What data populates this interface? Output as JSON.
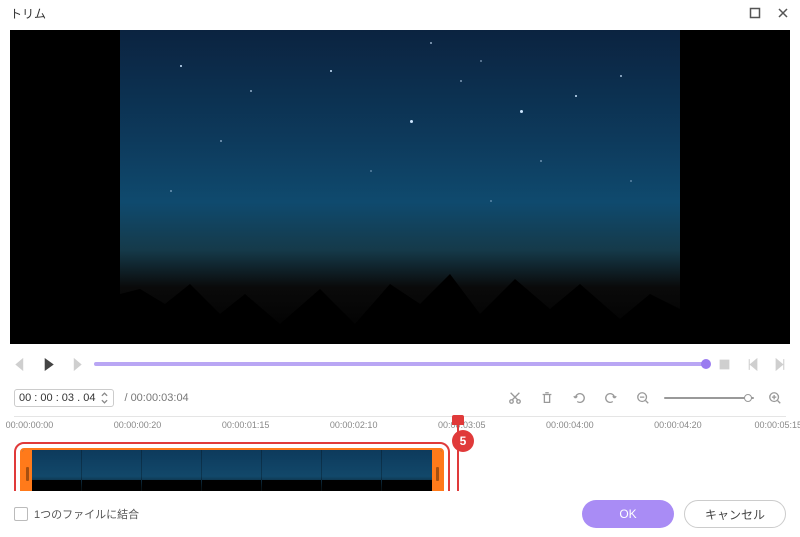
{
  "window": {
    "title": "トリム"
  },
  "playback": {
    "current_time": "00 : 00 : 03 . 04",
    "duration_text": "/ 00:00:03:04"
  },
  "timeline": {
    "ticks": [
      "00:00:00:00",
      "00:00:00:20",
      "00:00:01:15",
      "00:00:02:10",
      "00:00:03:05",
      "00:00:04:00",
      "00:00:04:20",
      "00:00:05:15"
    ]
  },
  "annotation": {
    "badge_5": "5"
  },
  "footer": {
    "merge_label": "1つのファイルに結合",
    "ok": "OK",
    "cancel": "キャンセル"
  }
}
